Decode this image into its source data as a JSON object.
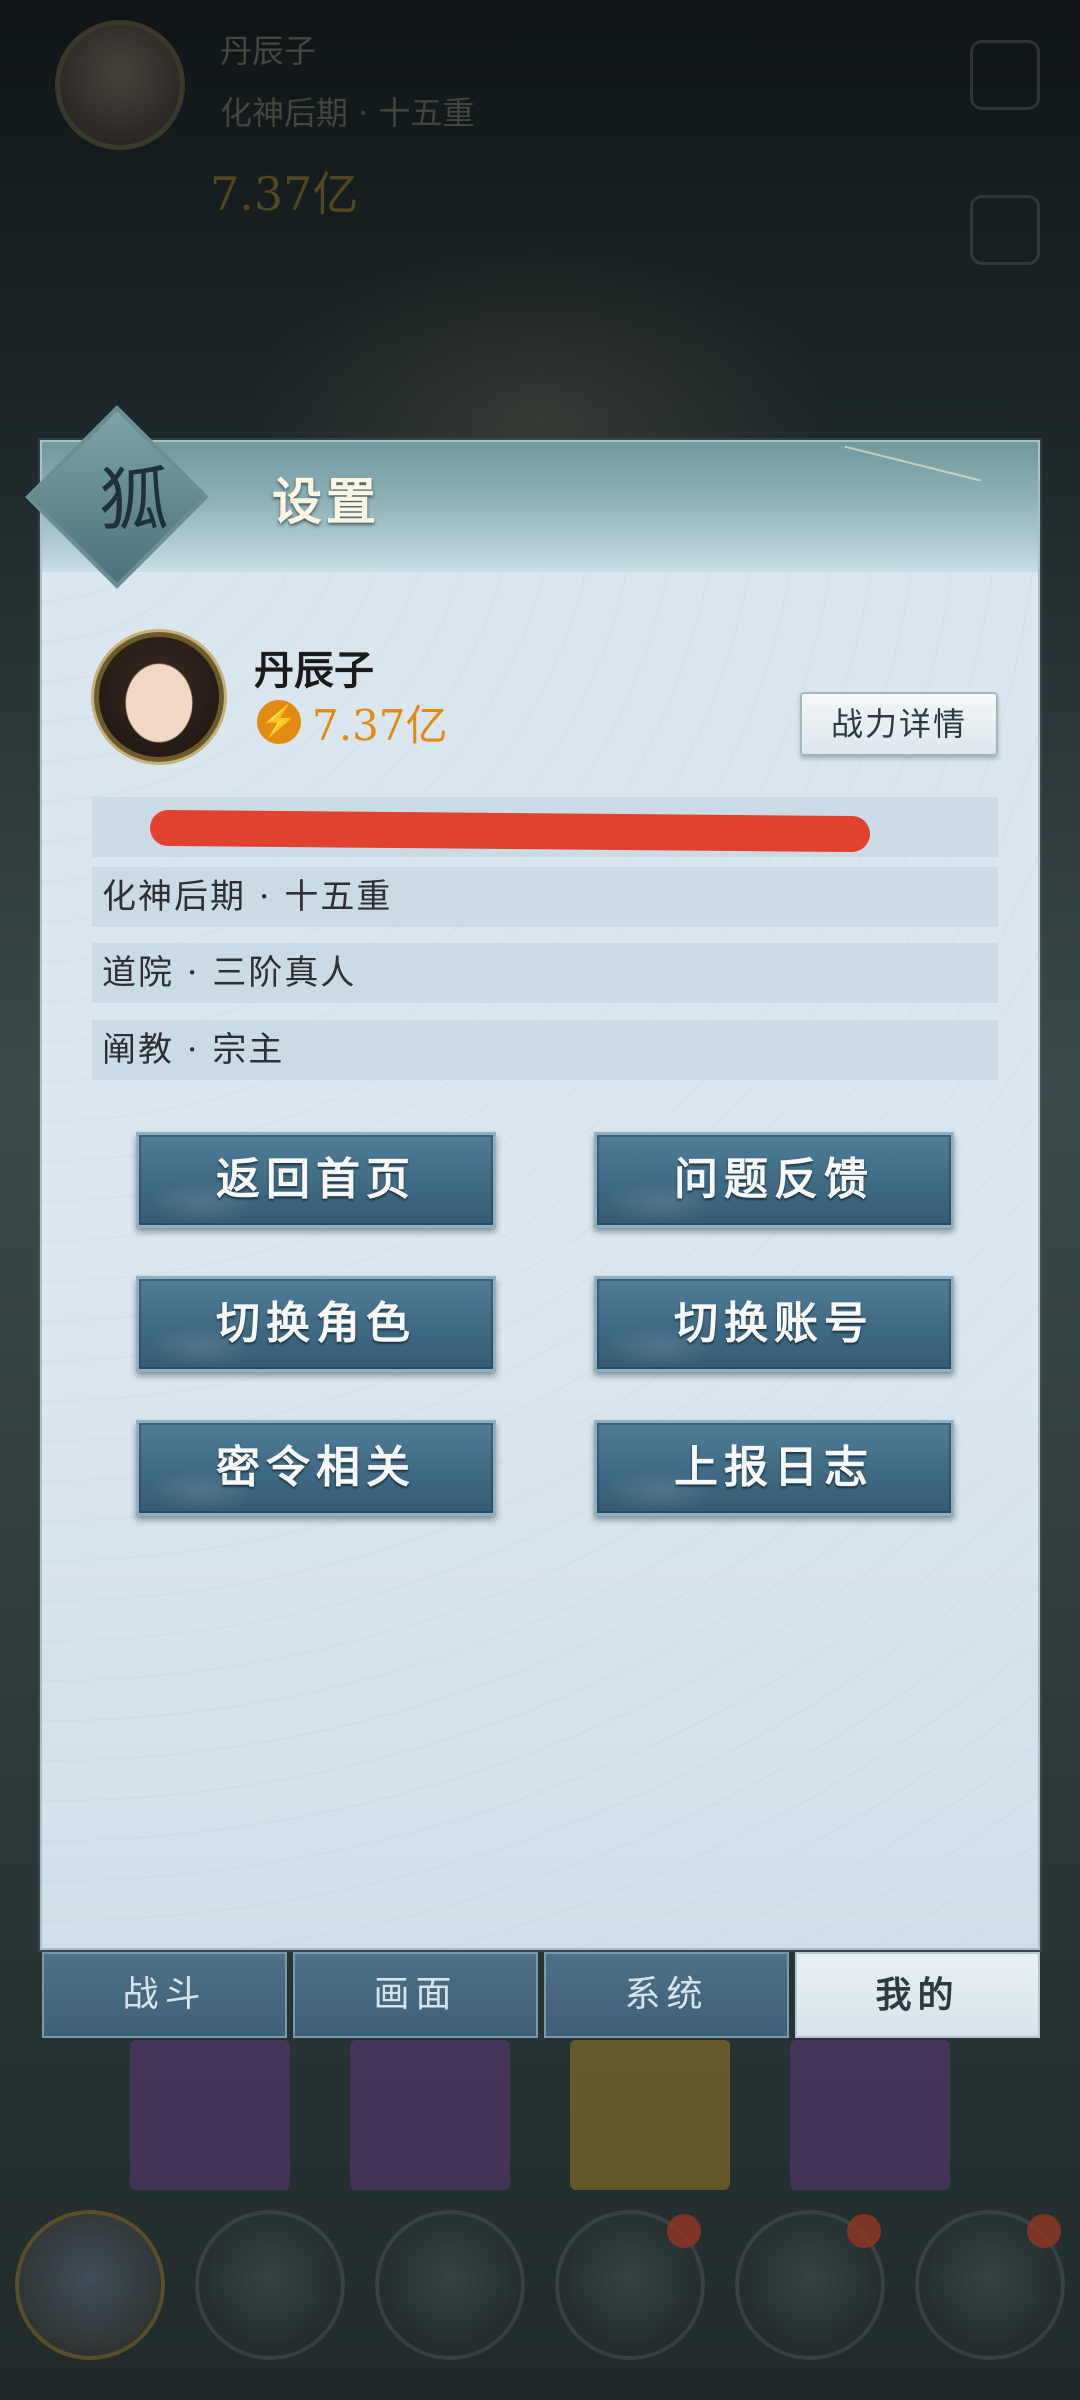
{
  "background": {
    "player_name": "丹辰子",
    "realm": "化神后期 · 十五重",
    "power": "7.37亿"
  },
  "dialog": {
    "title": "设置",
    "profile": {
      "name": "丹辰子",
      "power": "7.37亿",
      "power_icon": "power-icon",
      "detail_button": "战力详情"
    },
    "info_rows": [
      {
        "text": ""
      },
      {
        "text": "化神后期 · 十五重"
      },
      {
        "text": "道院 · 三阶真人"
      },
      {
        "text": "阐教 · 宗主"
      }
    ],
    "buttons": {
      "home": "返回首页",
      "feedback": "问题反馈",
      "switch_role": "切换角色",
      "switch_account": "切换账号",
      "password": "密令相关",
      "upload_log": "上报日志"
    },
    "tabs": [
      {
        "label": "战斗"
      },
      {
        "label": "画面"
      },
      {
        "label": "系统"
      },
      {
        "label": "我的",
        "active": true
      }
    ]
  },
  "colors": {
    "power_orange": "#e28a12",
    "button_blue": "#3f6a84",
    "redaction": "#e0422e"
  }
}
